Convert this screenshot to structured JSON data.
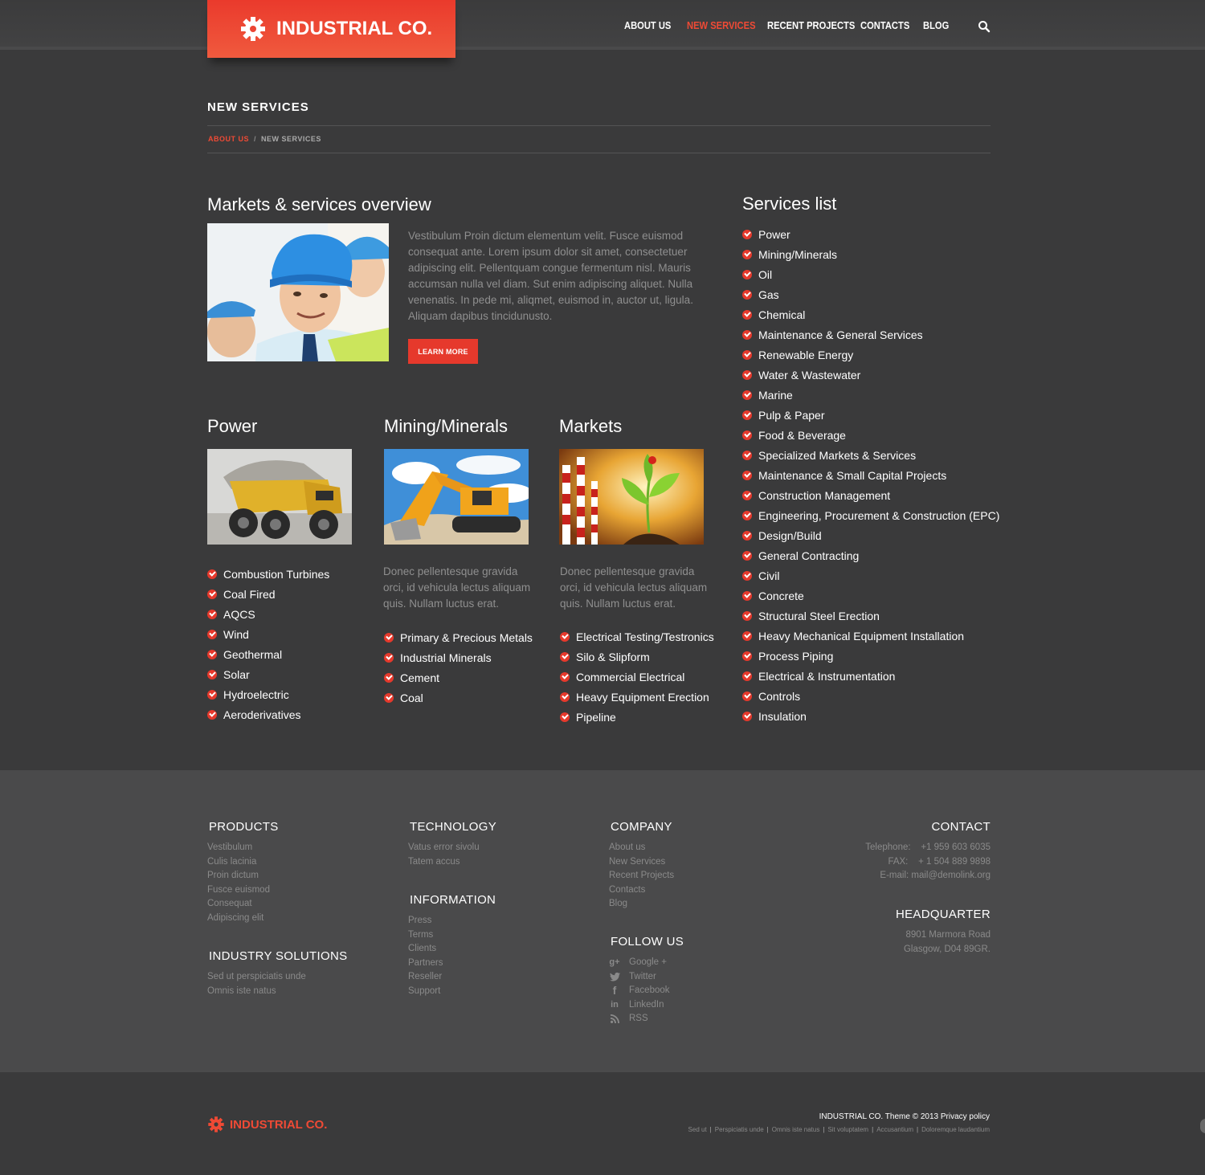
{
  "brand": {
    "name": "INDUSTRIAL CO.",
    "accent": "#ef4a35"
  },
  "nav": {
    "items": [
      {
        "label": "ABOUT US"
      },
      {
        "label": "NEW SERVICES"
      },
      {
        "label": "RECENT PROJECTS"
      },
      {
        "label": "CONTACTS"
      },
      {
        "label": "BLOG"
      }
    ],
    "active_index": 1,
    "search_icon": "search-icon"
  },
  "page": {
    "title": "NEW SERVICES",
    "breadcrumb": {
      "parent": "ABOUT US",
      "separator": "/",
      "current": "NEW SERVICES"
    }
  },
  "overview": {
    "heading": "Markets & services overview",
    "text": "Vestibulum Proin dictum elementum velit. Fusce euismod consequat ante. Lorem ipsum dolor sit amet, consectetuer adipiscing elit. Pellentquam congue fermentum nisl. Mauris accumsan nulla vel diam. Sut enim adipiscing aliquet. Nulla venenatis. In pede mi, aliqmet, euismod in, auctor ut, ligula. Aliquam dapibus tincidunusto.",
    "button": "LEARN MORE"
  },
  "power": {
    "heading": "Power",
    "items": [
      "Combustion Turbines",
      "Coal Fired",
      "AQCS",
      "Wind",
      "Geothermal",
      "Solar",
      "Hydroelectric",
      "Aeroderivatives"
    ]
  },
  "mining": {
    "heading": "Mining/Minerals",
    "text": "Donec pellentesque gravida orci, id vehicula lectus aliquam quis. Nullam luctus erat.",
    "items": [
      "Primary & Precious Metals",
      "Industrial Minerals",
      "Cement",
      "Coal"
    ]
  },
  "markets": {
    "heading": "Markets",
    "text": "Donec pellentesque gravida orci, id vehicula lectus aliquam quis. Nullam luctus erat.",
    "items": [
      "Electrical Testing/Testronics",
      "Silo & Slipform",
      "Commercial Electrical",
      "Heavy Equipment Erection",
      "Pipeline"
    ]
  },
  "services": {
    "heading": "Services list",
    "items": [
      "Power",
      "Mining/Minerals",
      "Oil",
      "Gas",
      "Chemical",
      "Maintenance & General Services",
      "Renewable Energy",
      "Water & Wastewater",
      "Marine",
      "Pulp & Paper",
      "Food & Beverage",
      "Specialized Markets & Services",
      "Maintenance & Small Capital Projects",
      "Construction Management",
      "Engineering, Procurement & Construction (EPC)",
      "Design/Build",
      "General Contracting",
      "Civil",
      "Concrete",
      "Structural Steel Erection",
      "Heavy Mechanical Equipment Installation",
      "Process Piping",
      "Electrical & Instrumentation",
      "Controls",
      "Insulation"
    ]
  },
  "footer": {
    "products": {
      "heading": "PRODUCTS",
      "items": [
        "Vestibulum",
        "Culis lacinia",
        "Proin dictum",
        "Fusce euismod",
        "Consequat",
        "Adipiscing elit"
      ]
    },
    "industry": {
      "heading": "INDUSTRY SOLUTIONS",
      "items": [
        "Sed ut perspiciatis unde",
        "Omnis iste natus"
      ]
    },
    "technology": {
      "heading": "TECHNOLOGY",
      "items": [
        "Vatus error sivolu",
        "Tatem accus"
      ]
    },
    "information": {
      "heading": "INFORMATION",
      "items": [
        "Press",
        "Terms",
        "Clients",
        "Partners",
        "Reseller",
        "Support"
      ]
    },
    "company": {
      "heading": "COMPANY",
      "items": [
        "About us",
        "New Services",
        "Recent Projects",
        "Contacts",
        "Blog"
      ]
    },
    "follow": {
      "heading": "FOLLOW US",
      "items": [
        {
          "label": "Google +",
          "icon": "google-plus-icon"
        },
        {
          "label": "Twitter",
          "icon": "twitter-icon"
        },
        {
          "label": "Facebook",
          "icon": "facebook-icon"
        },
        {
          "label": "LinkedIn",
          "icon": "linkedin-icon"
        },
        {
          "label": "RSS",
          "icon": "rss-icon"
        }
      ]
    },
    "contact": {
      "heading": "CONTACT",
      "lines": [
        "Telephone:    +1 959 603 6035",
        "FAX:    + 1 504 889 9898",
        "E-mail: mail@demolink.org"
      ]
    },
    "headquarter": {
      "heading": "HEADQUARTER",
      "lines": [
        "8901 Marmora Road",
        "Glasgow, D04 89GR."
      ]
    }
  },
  "bottom": {
    "brand": "INDUSTRIAL CO.",
    "copyright": "INDUSTRIAL CO. Theme © 2013 Privacy policy",
    "links": [
      "Sed ut",
      "Perspiciatis unde",
      "Omnis iste natus",
      "Sit voluptatem",
      "Accusantium",
      "Doloremque laudantium"
    ]
  }
}
